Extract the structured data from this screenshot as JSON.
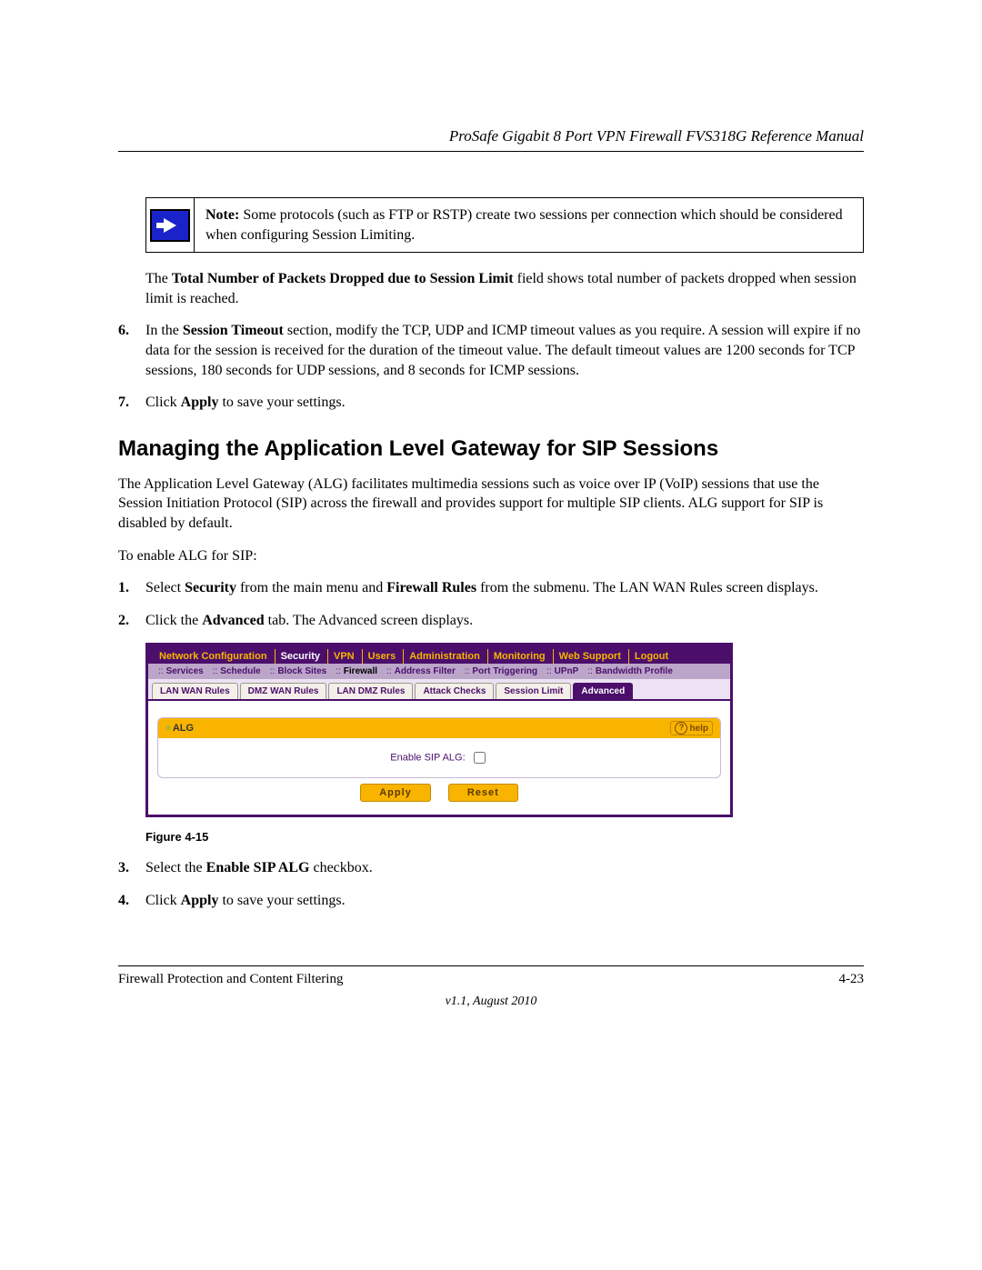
{
  "header_title": "ProSafe Gigabit 8 Port VPN Firewall FVS318G Reference Manual",
  "note": {
    "label": "Note:",
    "text": " Some protocols (such as FTP or RSTP) create two sessions per connection which should be considered when configuring Session Limiting."
  },
  "para_total_packets_prefix": "The ",
  "para_total_packets_bold": "Total Number of Packets Dropped due to Session Limit",
  "para_total_packets_suffix": " field shows total number of packets dropped when session limit is reached.",
  "step6": {
    "num": "6.",
    "prefix": "In the ",
    "bold": "Session Timeout",
    "suffix": " section, modify the TCP, UDP and ICMP timeout values as you require. A session will expire if no data for the session is received for the duration of the timeout value. The default timeout values are 1200 seconds for TCP sessions, 180 seconds for UDP sessions, and 8 seconds for ICMP sessions."
  },
  "step7": {
    "num": "7.",
    "prefix": "Click ",
    "bold": "Apply",
    "suffix": " to save your settings."
  },
  "section_heading": "Managing the Application Level Gateway for SIP Sessions",
  "intro_para": "The Application Level Gateway (ALG) facilitates multimedia sessions such as voice over IP (VoIP) sessions that use the Session Initiation Protocol (SIP) across the firewall and provides support for multiple SIP clients. ALG support for SIP is disabled by default.",
  "lead_in": "To enable ALG for SIP:",
  "sip_step1": {
    "num": "1.",
    "p1": "Select ",
    "b1": "Security",
    "p2": " from the main menu and ",
    "b2": "Firewall Rules",
    "p3": " from the submenu. The LAN WAN Rules screen displays."
  },
  "sip_step2": {
    "num": "2.",
    "p1": "Click the ",
    "b1": "Advanced",
    "p2": " tab. The Advanced screen displays."
  },
  "figure": {
    "main_tabs": [
      "Network Configuration",
      "Security",
      "VPN",
      "Users",
      "Administration",
      "Monitoring",
      "Web Support",
      "Logout"
    ],
    "main_active_index": 1,
    "sub_tabs": [
      "Services",
      "Schedule",
      "Block Sites",
      "Firewall",
      "Address Filter",
      "Port Triggering",
      "UPnP",
      "Bandwidth Profile"
    ],
    "sub_active_index": 3,
    "page_tabs": [
      "LAN WAN Rules",
      "DMZ WAN Rules",
      "LAN DMZ Rules",
      "Attack Checks",
      "Session Limit",
      "Advanced"
    ],
    "page_active_index": 5,
    "panel_title": "ALG",
    "help_label": "help",
    "field_label": "Enable SIP ALG:",
    "apply_label": "Apply",
    "reset_label": "Reset"
  },
  "figure_caption": "Figure 4-15",
  "sip_step3": {
    "num": "3.",
    "p1": "Select the ",
    "b1": "Enable SIP ALG",
    "p2": " checkbox."
  },
  "sip_step4": {
    "num": "4.",
    "p1": "Click ",
    "b1": "Apply",
    "p2": " to save your settings."
  },
  "footer": {
    "chapter": "Firewall Protection and Content Filtering",
    "page": "4-23",
    "version": "v1.1, August 2010"
  }
}
